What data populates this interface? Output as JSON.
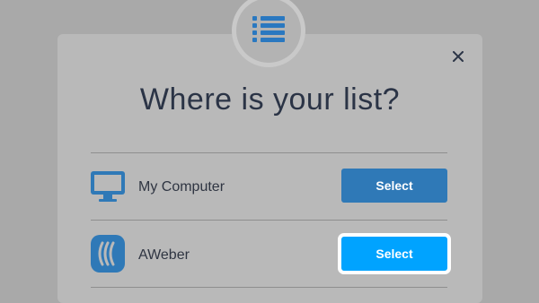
{
  "modal": {
    "title": "Where is your list?",
    "header_icon": "list-icon",
    "close_icon": "close-icon"
  },
  "sources": [
    {
      "label": "My Computer",
      "icon": "computer-monitor-icon",
      "button_label": "Select",
      "state": "default"
    },
    {
      "label": "AWeber",
      "icon": "aweber-logo-icon",
      "button_label": "Select",
      "state": "focused"
    }
  ],
  "colors": {
    "accent": "#00a3ff",
    "dimmed_accent": "#2f79b7",
    "title_text": "#2b3446",
    "overlay": "#a9a9a9"
  }
}
